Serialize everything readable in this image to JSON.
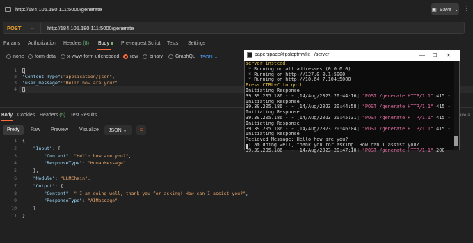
{
  "topbar": {
    "url": "http://184.105.180.111:5000/generate",
    "save_label": "Save",
    "more": "⋮"
  },
  "request": {
    "method": "POST",
    "url": "http://184.105.180.111:5000/generate"
  },
  "request_tabs": [
    {
      "label": "Params"
    },
    {
      "label": "Authorization"
    },
    {
      "label": "Headers",
      "count": "(8)"
    },
    {
      "label": "Body"
    },
    {
      "label": "Pre-request Script"
    },
    {
      "label": "Tests"
    },
    {
      "label": "Settings"
    }
  ],
  "body_options": {
    "none": "none",
    "form_data": "form-data",
    "urlencoded": "x-www-form-urlencoded",
    "raw": "raw",
    "binary": "binary",
    "graphql": "GraphQL",
    "format": "JSON"
  },
  "request_body": {
    "lines": [
      "1",
      "2",
      "3",
      "4"
    ],
    "open_brace": "{",
    "key1": "\"Content-Type\"",
    "val1": "\"application/json\"",
    "key2": "\"user_message\"",
    "val2": "\"Hello how are you?\"",
    "close_brace": "}"
  },
  "response_tabs": {
    "body": "Body",
    "cookies": "Cookies",
    "headers": "Headers",
    "headers_count": "(5)",
    "test_results": "Test Results"
  },
  "view_buttons": {
    "pretty": "Pretty",
    "raw": "Raw",
    "preview": "Preview",
    "visualize": "Visualize",
    "format": "JSON"
  },
  "response_side_label": "ave a",
  "response_body": {
    "line_numbers": [
      "1",
      "2",
      "3",
      "4",
      "5",
      "6",
      "7",
      "8",
      "9",
      "10",
      "11"
    ],
    "lines": [
      "{",
      "    \"Input\": {",
      "        \"Content\": \"Hello how are you?\",",
      "        \"ResponseType\": \"HumanMessage\"",
      "    },",
      "    \"Module\": \"LLMChain\",",
      "    \"Output\": {",
      "        \"Content\": \" I am doing well, thank you for asking! How can I assist you?\",",
      "        \"ResponseType\": \"AIMessage\"",
      "    }",
      "}"
    ]
  },
  "terminal": {
    "title": "paperspace@psleptmwlli: ~/server",
    "lines": [
      {
        "t": "server instead.",
        "k": "warn"
      },
      {
        "t": " * Running on all addresses (0.0.0.0)",
        "k": "info"
      },
      {
        "t": " * Running on http://127.0.0.1:5000",
        "k": "info"
      },
      {
        "t": " * Running on http://10.64.7.104:5000",
        "k": "info"
      },
      {
        "t": "Press CTRL+C to quit",
        "k": "warn"
      },
      {
        "t": "Initiating Response",
        "k": "info"
      },
      {
        "t": "39.39.205.186 - - [14/Aug/2023 20:44:16] \"POST /generate HTTP/1.1\" 415 -",
        "k": "info"
      },
      {
        "t": "Initiating Response",
        "k": "info"
      },
      {
        "t": "39.39.205.186 - - [14/Aug/2023 20:44:58] \"POST /generate HTTP/1.1\" 415 -",
        "k": "info"
      },
      {
        "t": "Initiating Response",
        "k": "info"
      },
      {
        "t": "39.39.205.186 - - [14/Aug/2023 20:45:31] \"POST /generate HTTP/1.1\" 415 -",
        "k": "info"
      },
      {
        "t": "Initiating Response",
        "k": "info"
      },
      {
        "t": "39.39.205.186 - - [14/Aug/2023 20:46:04] \"POST /generate HTTP/1.1\" 415 -",
        "k": "info"
      },
      {
        "t": "Initiating Response",
        "k": "info"
      },
      {
        "t": "Recieved Message: Hello how are you?",
        "k": "info"
      },
      {
        "t": " I am doing well, thank you for asking! How can I assist you?",
        "k": "info"
      },
      {
        "t": "39.39.205.186 - - [14/Aug/2023 20:47:10] \"POST /generate HTTP/1.1\" 200 -",
        "k": "info"
      }
    ]
  },
  "colors": {
    "accent": "#ff6c37",
    "method": "#f5a623",
    "count": "#6dbe74",
    "link_blue": "#4aa3ff"
  }
}
